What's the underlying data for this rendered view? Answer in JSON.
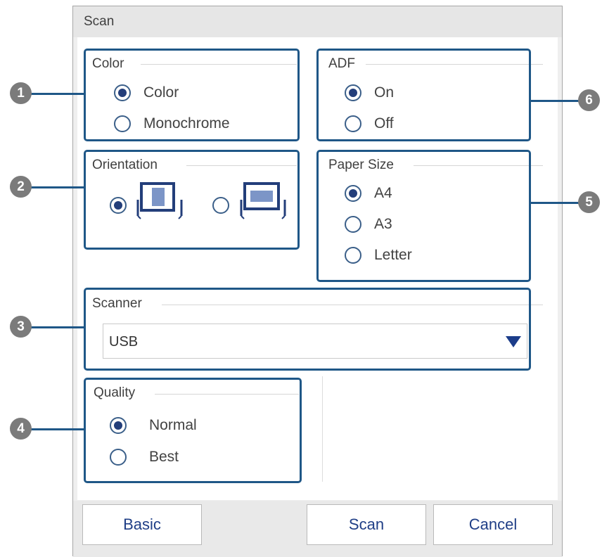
{
  "window": {
    "title": "Scan"
  },
  "color_group": {
    "title": "Color",
    "options": [
      {
        "label": "Color",
        "selected": true
      },
      {
        "label": "Monochrome",
        "selected": false
      }
    ]
  },
  "orientation_group": {
    "title": "Orientation",
    "options": [
      {
        "icon": "portrait-orientation-icon",
        "selected": true
      },
      {
        "icon": "landscape-orientation-icon",
        "selected": false
      }
    ]
  },
  "adf_group": {
    "title": "ADF",
    "options": [
      {
        "label": "On",
        "selected": true
      },
      {
        "label": "Off",
        "selected": false
      }
    ]
  },
  "paper_size_group": {
    "title": "Paper Size",
    "options": [
      {
        "label": "A4",
        "selected": true
      },
      {
        "label": "A3",
        "selected": false
      },
      {
        "label": "Letter",
        "selected": false
      }
    ]
  },
  "scanner_group": {
    "title": "Scanner",
    "selected_value": "USB"
  },
  "quality_group": {
    "title": "Quality",
    "options": [
      {
        "label": "Normal",
        "selected": true
      },
      {
        "label": "Best",
        "selected": false
      }
    ]
  },
  "buttons": {
    "basic": "Basic",
    "scan": "Scan",
    "cancel": "Cancel"
  },
  "callouts": [
    "1",
    "2",
    "3",
    "4",
    "5",
    "6"
  ],
  "colors": {
    "accent": "#1f5787",
    "radio_fill": "#233e7a",
    "button_text": "#1f3e86",
    "callout_bg": "#7b7b7b"
  }
}
